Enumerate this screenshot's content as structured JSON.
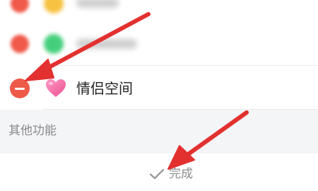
{
  "list": {
    "selected_item": {
      "label": "情侣空间",
      "icon": "heart-icon"
    }
  },
  "section": {
    "title": "其他功能"
  },
  "footer": {
    "done_label": "完成",
    "done_icon": "check-icon"
  },
  "colors": {
    "remove": "#ee5a4a",
    "annotation_arrow": "#e2312f",
    "heart": "#f36aa8"
  }
}
